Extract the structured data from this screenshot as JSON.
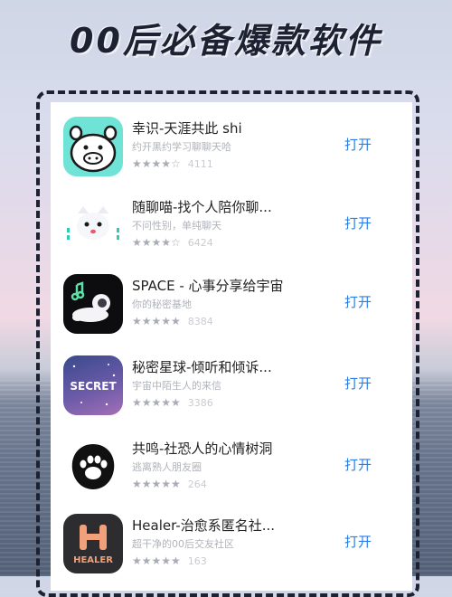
{
  "headline": "00后必备爆款软件",
  "apps": [
    {
      "name": "幸识-天涯共此 shi",
      "subtitle": "约开黑约学习聊聊天哈",
      "stars": "★★★★☆",
      "count": "4111",
      "action": "打开"
    },
    {
      "name": "随聊喵-找个人陪你聊...",
      "subtitle": "不问性别，单纯聊天",
      "stars": "★★★★☆",
      "count": "6424",
      "action": "打开"
    },
    {
      "name": "SPACE - 心事分享给宇宙",
      "subtitle": "你的秘密基地",
      "stars": "★★★★★",
      "count": "8384",
      "action": "打开"
    },
    {
      "name": "秘密星球-倾听和倾诉...",
      "subtitle": "宇宙中陌生人的来信",
      "stars": "★★★★★",
      "count": "3386",
      "action": "打开"
    },
    {
      "name": "共鸣-社恐人的心情树洞",
      "subtitle": "逃离熟人朋友圈",
      "stars": "★★★★★",
      "count": "264",
      "action": "打开"
    },
    {
      "name": "Healer-治愈系匿名社...",
      "subtitle": "超干净的00后交友社区",
      "stars": "★★★★★",
      "count": "163",
      "action": "打开"
    }
  ],
  "icon_text": {
    "secret": "SECRET",
    "healer": "HEALER"
  }
}
